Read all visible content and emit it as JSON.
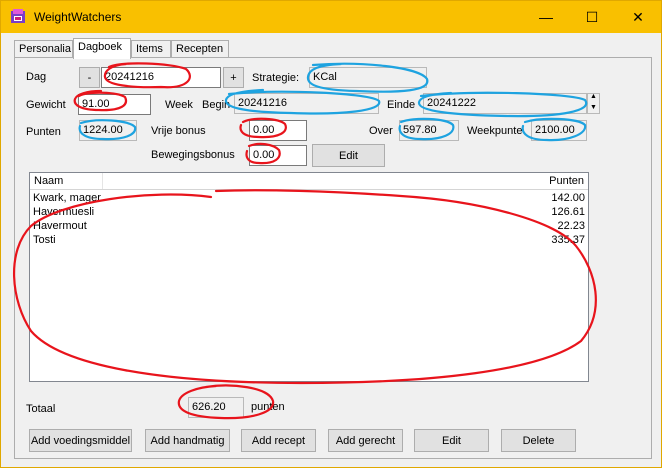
{
  "window": {
    "title": "WeightWatchers",
    "minimize": "—",
    "maximize": "☐",
    "close": "✕"
  },
  "tabs": [
    {
      "label": "Personalia"
    },
    {
      "label": "Dagboek"
    },
    {
      "label": "Items"
    },
    {
      "label": "Recepten"
    }
  ],
  "dagboek": {
    "dag_label": "Dag",
    "prev_label": "-",
    "date_value": "20241216",
    "next_label": "+",
    "strategie_label": "Strategie:",
    "strategie_value": "KCal",
    "gewicht_label": "Gewicht",
    "gewicht_value": "91.00",
    "week_label": "Week",
    "begin_label": "Begin",
    "begin_value": "20241216",
    "einde_label": "Einde",
    "einde_value": "20241222",
    "punten_label": "Punten",
    "punten_value": "1224.00",
    "vrije_bonus_label": "Vrije bonus",
    "vrije_bonus_value": "0.00",
    "over_label": "Over",
    "over_value": "597.80",
    "weekpunten_label": "Weekpunte",
    "weekpunten_value": "2100.00",
    "bewegingsbonus_label": "Bewegingsbonus",
    "bewegingsbonus_value": "0.00",
    "edit_label": "Edit"
  },
  "list": {
    "col_naam": "Naam",
    "col_punten": "Punten",
    "rows": [
      {
        "naam": "Kwark, mager",
        "punten": "142.00"
      },
      {
        "naam": "Havermuesli",
        "punten": "126.61"
      },
      {
        "naam": "Havermout",
        "punten": "22.23"
      },
      {
        "naam": "Tosti",
        "punten": "335.37"
      }
    ]
  },
  "totaal": {
    "label": "Totaal",
    "value": "626.20",
    "unit": "punten"
  },
  "buttons": {
    "add_voedingsmiddel": "Add voedingsmiddel",
    "add_handmatig": "Add handmatig",
    "add_recept": "Add recept",
    "add_gerecht": "Add gerecht",
    "edit": "Edit",
    "delete": "Delete"
  },
  "colors": {
    "titlebar": "#f9c000",
    "annotation_red": "#e8141c",
    "annotation_blue": "#1ea3e0"
  }
}
